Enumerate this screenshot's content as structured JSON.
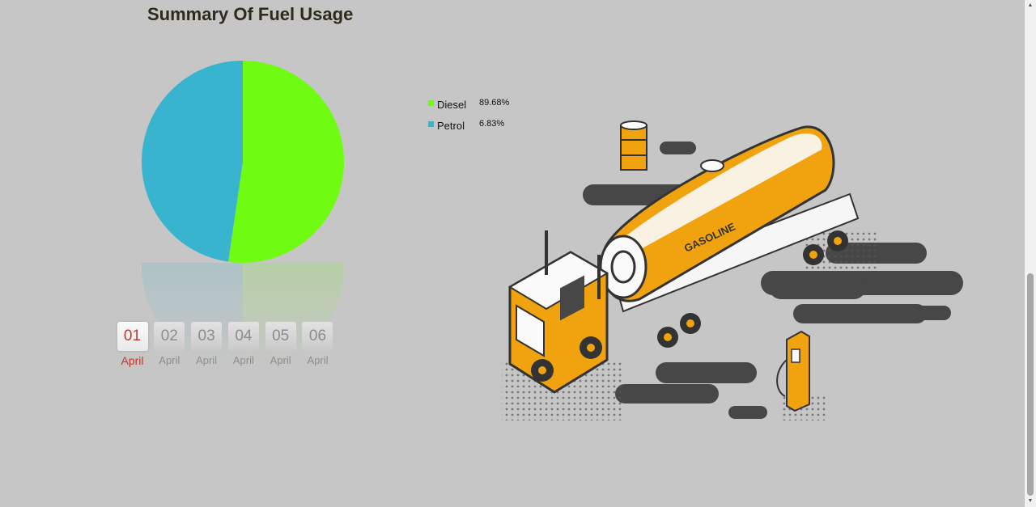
{
  "page": {
    "title": "Summary Of Fuel Usage"
  },
  "chart_data": {
    "type": "pie",
    "title": "Summary Of Fuel Usage",
    "slices": [
      {
        "name": "Diesel",
        "label": "89.68%",
        "value": 52.3,
        "color": "#6ffb12"
      },
      {
        "name": "Petrol",
        "label": "6.83%",
        "value": 47.7,
        "color": "#39b4cf"
      }
    ],
    "legend_position": "right"
  },
  "legend": {
    "items": [
      {
        "name": "Diesel",
        "value": "89.68%",
        "color": "#6ffb12"
      },
      {
        "name": "Petrol",
        "value": "6.83%",
        "color": "#39b4cf"
      }
    ]
  },
  "dates": {
    "selected_index": 0,
    "items": [
      {
        "day": "01",
        "month": "April"
      },
      {
        "day": "02",
        "month": "April"
      },
      {
        "day": "03",
        "month": "April"
      },
      {
        "day": "04",
        "month": "April"
      },
      {
        "day": "05",
        "month": "April"
      },
      {
        "day": "06",
        "month": "April"
      }
    ]
  },
  "illustration": {
    "tank_text": "GASOLINE",
    "icon": "fuel-tanker-truck-illustration",
    "accent_color": "#f0a30e",
    "dark_color": "#474747"
  }
}
